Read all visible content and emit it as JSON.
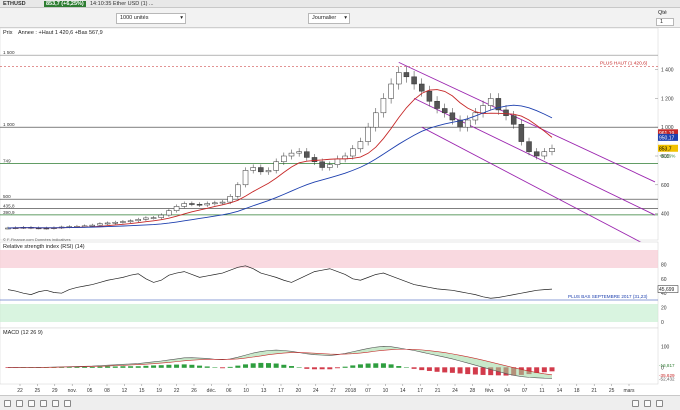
{
  "topbar": {
    "ticker": "ETHUSD",
    "price_badge": "853,7 (+6,25%)",
    "status": "14:10:35 Ether USD (1) ..."
  },
  "toolbar": {
    "quantity_select": "1000 unités",
    "period_select": "Journalier",
    "qte_label": "Qté",
    "qte_value": "1"
  },
  "price_panel": {
    "label": "Prix",
    "info": "Annee : +Haut 1 420,6 +Bas 567,9",
    "copyright": "© F-Finance.com Données indicatives",
    "hline_labels": [
      "1 500",
      "1 000",
      "749",
      "500",
      "435,8",
      "390,9"
    ],
    "plus_haut_label": "PLUS HAUT (1 420,6)",
    "y_ticks": [
      "1 400",
      "1 200",
      "1 000",
      "800",
      "600",
      "400"
    ],
    "badge_red": "961,19",
    "badge_blue": "950,17",
    "badge_last": "853,7",
    "badge_change": "+6,26%",
    "colors": {
      "red_ma": "#c62828",
      "blue_ma": "#1e40af",
      "channel": "#9c27b0",
      "green_line": "#2e7d32",
      "candle_up": "#ffffff",
      "candle_down": "#555555"
    }
  },
  "rsi_panel": {
    "label": "Relative strength index (RSI) (14)",
    "y_ticks": [
      "80",
      "60",
      "40",
      "20",
      "0"
    ],
    "plus_bas_label": "PLUS BAS SEPTEMBRE 2017 (31,23)",
    "value_badge": "45,699"
  },
  "macd_panel": {
    "label": "MACD (12 26 9)",
    "y_ticks": [
      "100",
      "0"
    ],
    "badge_values": [
      "-35,629",
      "-52,432",
      "-16,817"
    ]
  },
  "x_axis": {
    "labels": [
      "22",
      "25",
      "29",
      "nov.",
      "05",
      "08",
      "12",
      "15",
      "19",
      "22",
      "26",
      "déc.",
      "06",
      "10",
      "13",
      "17",
      "20",
      "24",
      "27",
      "2018",
      "07",
      "10",
      "14",
      "17",
      "21",
      "24",
      "28",
      "févr.",
      "04",
      "07",
      "11",
      "14",
      "18",
      "21",
      "25",
      "mars"
    ]
  },
  "chart_data": {
    "type": "candlestick",
    "price": {
      "close": [
        300,
        302,
        305,
        301,
        300,
        298,
        302,
        307,
        310,
        312,
        315,
        320,
        330,
        335,
        340,
        345,
        350,
        360,
        370,
        372,
        390,
        420,
        450,
        470,
        465,
        460,
        470,
        475,
        480,
        520,
        600,
        700,
        720,
        690,
        700,
        760,
        800,
        820,
        830,
        790,
        760,
        720,
        740,
        780,
        800,
        850,
        900,
        1000,
        1100,
        1200,
        1300,
        1380,
        1350,
        1300,
        1250,
        1180,
        1130,
        1100,
        1050,
        1000,
        1050,
        1100,
        1150,
        1200,
        1120,
        1080,
        1020,
        900,
        830,
        800,
        830,
        853.7
      ],
      "red_ma_last": 961.19,
      "blue_ma_last": 950.17,
      "ylim": [
        300,
        1550
      ]
    },
    "rsi": {
      "values": [
        45,
        43,
        40,
        38,
        42,
        44,
        41,
        40,
        45,
        48,
        50,
        52,
        55,
        58,
        60,
        62,
        65,
        67,
        60,
        55,
        58,
        65,
        68,
        70,
        66,
        62,
        64,
        66,
        68,
        72,
        76,
        78,
        74,
        68,
        65,
        62,
        58,
        55,
        60,
        65,
        70,
        72,
        74,
        70,
        66,
        60,
        58,
        62,
        66,
        68,
        64,
        60,
        56,
        52,
        50,
        48,
        46,
        45,
        44,
        42,
        40,
        38,
        35,
        33,
        34,
        36,
        38,
        40,
        42,
        44,
        45,
        45.7
      ],
      "ylim": [
        0,
        100
      ]
    },
    "macd": {
      "macd": [
        -2,
        -2,
        -1,
        -1,
        0,
        0,
        1,
        2,
        3,
        4,
        5,
        6,
        8,
        10,
        12,
        14,
        16,
        18,
        22,
        26,
        30,
        35,
        40,
        45,
        46,
        44,
        42,
        38,
        36,
        40,
        48,
        58,
        68,
        75,
        80,
        82,
        80,
        76,
        70,
        64,
        60,
        58,
        56,
        60,
        66,
        74,
        82,
        90,
        96,
        100,
        98,
        92,
        86,
        80,
        72,
        64,
        56,
        48,
        40,
        30,
        20,
        10,
        0,
        -10,
        -20,
        -30,
        -38,
        -44,
        -48,
        -50,
        -52,
        -52.4
      ],
      "signal": [
        -1,
        -1,
        -1,
        -1,
        -1,
        0,
        0,
        1,
        2,
        2,
        3,
        4,
        5,
        6,
        8,
        9,
        11,
        13,
        15,
        17,
        20,
        23,
        27,
        31,
        34,
        36,
        38,
        38,
        38,
        38,
        40,
        44,
        49,
        54,
        60,
        64,
        68,
        70,
        70,
        69,
        67,
        65,
        63,
        62,
        63,
        65,
        68,
        72,
        77,
        81,
        84,
        86,
        86,
        85,
        83,
        79,
        75,
        70,
        64,
        57,
        50,
        42,
        34,
        25,
        16,
        7,
        -2,
        -10,
        -18,
        -25,
        -31,
        -35.6
      ],
      "ylim": [
        -70,
        130
      ]
    }
  }
}
